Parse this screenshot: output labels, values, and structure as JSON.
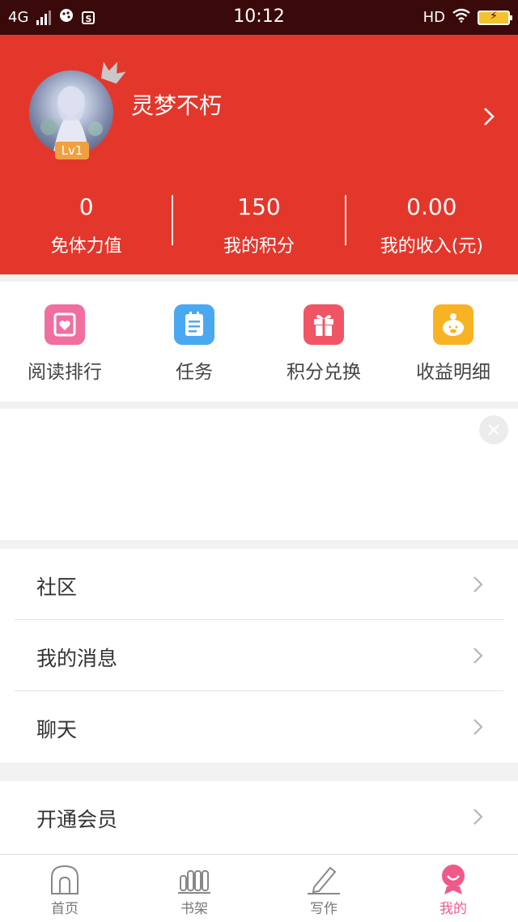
{
  "status_bar": {
    "network": "4G",
    "time": "10:12",
    "hd": "HD",
    "s_badge": "S"
  },
  "profile": {
    "nickname": "灵梦不朽",
    "level": "Lv1"
  },
  "stats": [
    {
      "value": "0",
      "label": "免体力值"
    },
    {
      "value": "150",
      "label": "我的积分"
    },
    {
      "value": "0.00",
      "label": "我的收入(元)"
    }
  ],
  "quick_actions": [
    {
      "label": "阅读排行",
      "icon": "reading-rank-icon",
      "color": "#f06fa0"
    },
    {
      "label": "任务",
      "icon": "task-icon",
      "color": "#4aa8f0"
    },
    {
      "label": "积分兑换",
      "icon": "gift-icon",
      "color": "#f05565"
    },
    {
      "label": "收益明细",
      "icon": "piggy-bank-icon",
      "color": "#f7b324"
    }
  ],
  "menu": {
    "community": "社区",
    "messages": "我的消息",
    "chat": "聊天",
    "vip": "开通会员"
  },
  "tabs": [
    {
      "label": "首页",
      "icon": "home-icon"
    },
    {
      "label": "书架",
      "icon": "bookshelf-icon"
    },
    {
      "label": "写作",
      "icon": "pen-icon"
    },
    {
      "label": "我的",
      "icon": "profile-icon"
    }
  ],
  "colors": {
    "header_red": "#e4372c",
    "status_bar": "#3a0a0a",
    "active_tab": "#ef5a8a"
  }
}
